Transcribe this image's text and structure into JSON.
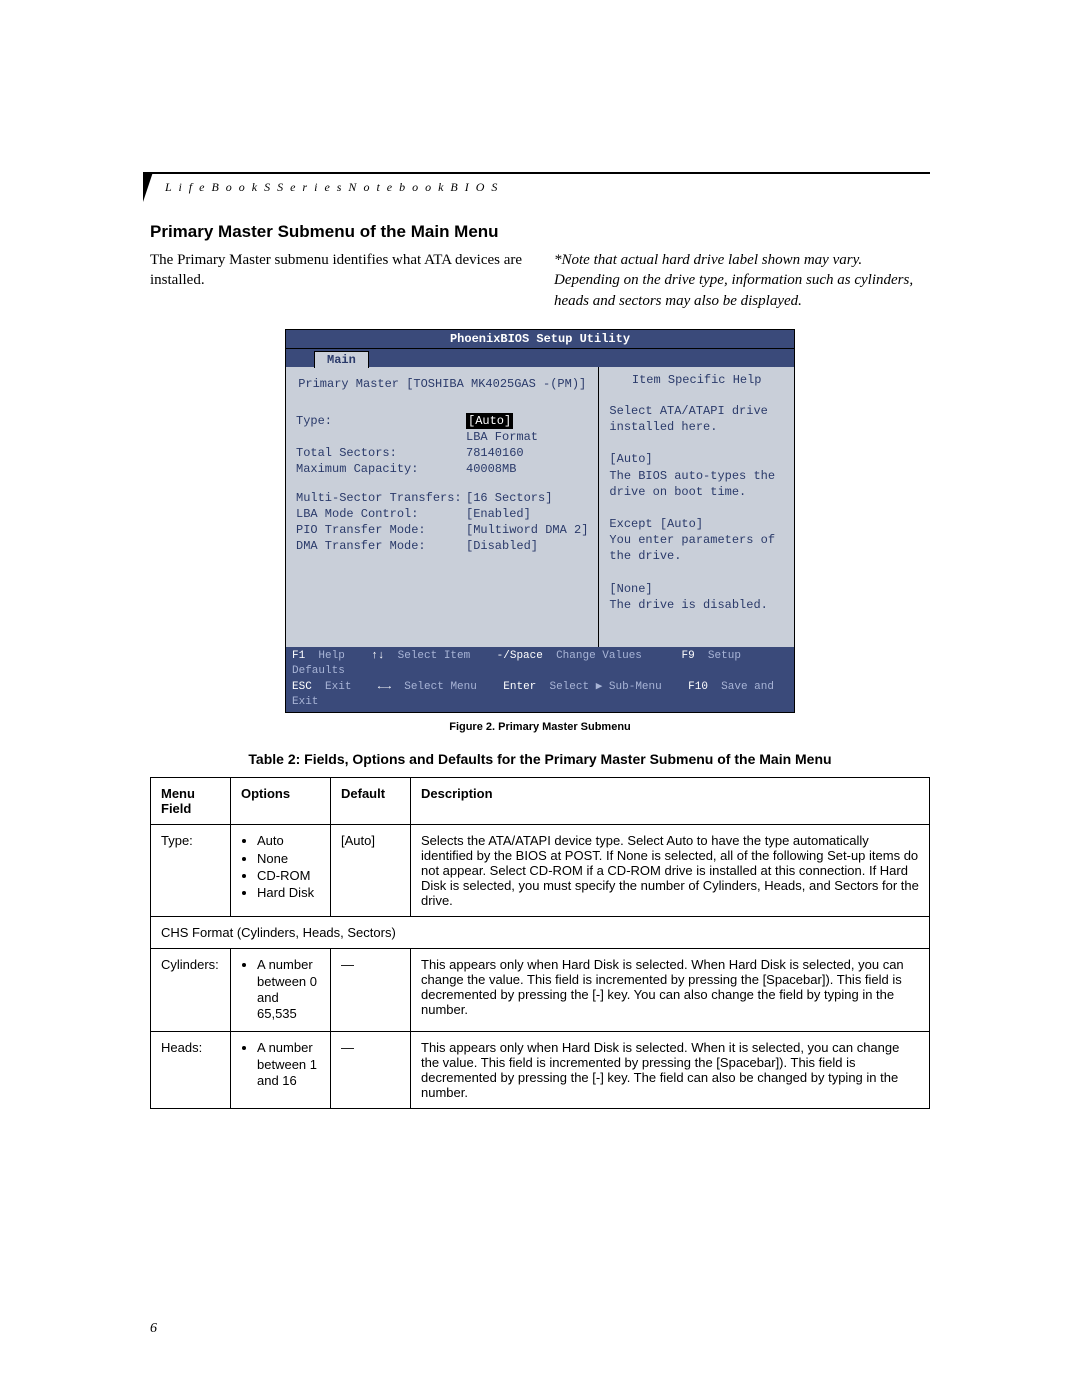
{
  "header": {
    "running_head": "L i f e B o o k   S   S e r i e s   N o t e b o o k   B I O S"
  },
  "section": {
    "title": "Primary Master Submenu of the Main Menu",
    "intro_left": "The Primary Master submenu identifies what ATA devices are installed.",
    "intro_right": "*Note that actual hard drive label shown may vary. Depending on the drive type, information such as cylinders, heads and sectors may also be displayed."
  },
  "bios": {
    "utility_title": "PhoenixBIOS Setup Utility",
    "active_tab": "Main",
    "submenu_title": "Primary Master [TOSHIBA MK4025GAS -(PM)]",
    "help_title": "Item Specific Help",
    "fields": {
      "type_label": "Type:",
      "type_value": "[Auto]",
      "lba_format": "LBA Format",
      "total_sectors_label": "Total Sectors:",
      "total_sectors_value": "78140160",
      "max_capacity_label": "Maximum Capacity:",
      "max_capacity_value": "40008MB",
      "multi_sector_label": "Multi-Sector Transfers:",
      "multi_sector_value": "[16 Sectors]",
      "lba_mode_label": "LBA Mode Control:",
      "lba_mode_value": "[Enabled]",
      "pio_label": "PIO Transfer Mode:",
      "pio_value": "[Multiword DMA 2]",
      "dma_label": "DMA Transfer Mode:",
      "dma_value": "[Disabled]"
    },
    "help_text": "Select ATA/ATAPI drive installed here.\n\n[Auto]\nThe BIOS auto-types the drive on boot time.\n\nExcept [Auto]\nYou enter parameters of the drive.\n\n[None]\nThe drive is disabled.",
    "footer": {
      "f1": "F1",
      "help": "Help",
      "updown": "↑↓",
      "select_item": "Select Item",
      "minusspace": "-/Space",
      "change_values": "Change Values",
      "f9": "F9",
      "setup_defaults": "Setup Defaults",
      "esc": "ESC",
      "exit": "Exit",
      "leftright": "←→",
      "select_menu": "Select Menu",
      "enter": "Enter",
      "select_sub": "Select ▶ Sub-Menu",
      "f10": "F10",
      "save_exit": "Save and Exit"
    }
  },
  "figure_caption": "Figure 2.  Primary Master Submenu",
  "table": {
    "title": "Table 2: Fields, Options and Defaults for the Primary Master Submenu of the Main Menu",
    "headers": {
      "menu_field": "Menu Field",
      "options": "Options",
      "default": "Default",
      "description": "Description"
    },
    "rows": [
      {
        "menu_field": "Type:",
        "options": [
          "Auto",
          "None",
          "CD-ROM",
          "Hard Disk"
        ],
        "default": "[Auto]",
        "description": "Selects the ATA/ATAPI device type. Select Auto to have the type automatically identified by the BIOS at POST. If None is selected, all of the following Set-up items do not appear. Select CD-ROM if a CD-ROM drive is installed at this connection. If Hard Disk is selected, you must specify the number of Cylinders, Heads, and Sectors for the drive."
      },
      {
        "section": "CHS Format (Cylinders, Heads, Sectors)"
      },
      {
        "menu_field": "Cylinders:",
        "options": [
          "A number between 0 and 65,535"
        ],
        "default": "—",
        "description": "This appears only when Hard Disk is selected. When Hard Disk is selected, you can change the value. This field is incremented by pressing the [Spacebar]). This field is decremented by pressing the [-] key. You can also change the field by typing in the number."
      },
      {
        "menu_field": "Heads:",
        "options": [
          "A number between 1 and 16"
        ],
        "default": "—",
        "description": "This appears only when Hard Disk is selected. When it is selected, you can change the value. This field is incremented by pressing the [Spacebar]). This field is decremented by pressing the [-] key. The field can also be changed by typing in the number."
      }
    ]
  },
  "page_number": "6"
}
